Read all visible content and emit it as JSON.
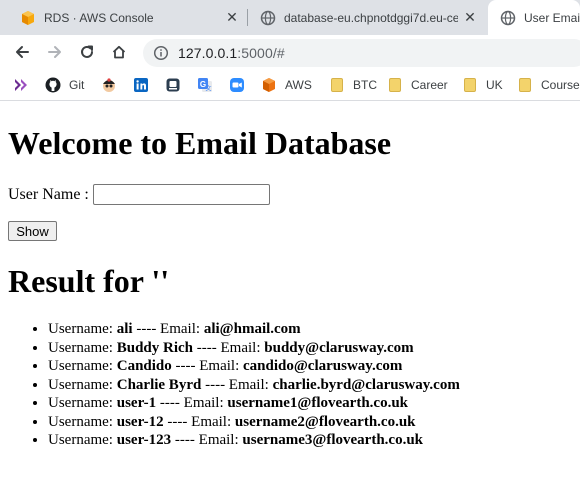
{
  "browser": {
    "tabs": [
      {
        "title": "RDS · AWS Console",
        "icon": "aws-box-icon",
        "active": false
      },
      {
        "title": "database-eu.chpnotdggi7d.eu-ce",
        "icon": "globe-icon",
        "active": false
      },
      {
        "title": "User Emails",
        "icon": "globe-icon",
        "active": true
      }
    ],
    "address": {
      "host": "127.0.0.1",
      "path": ":5000/#"
    },
    "bookmarks": [
      {
        "label": "",
        "icon": "chevrons-icon"
      },
      {
        "label": "Git",
        "icon": "github-icon"
      },
      {
        "label": "",
        "icon": "avatar-icon"
      },
      {
        "label": "",
        "icon": "linkedin-icon"
      },
      {
        "label": "",
        "icon": "bookmark-app-icon"
      },
      {
        "label": "",
        "icon": "google-translate-icon"
      },
      {
        "label": "",
        "icon": "zoom-icon"
      },
      {
        "label": "AWS",
        "icon": "aws-box-icon"
      },
      {
        "label": "BTC",
        "icon": "folder-icon"
      },
      {
        "label": "Career",
        "icon": "folder-icon"
      },
      {
        "label": "UK",
        "icon": "folder-icon"
      },
      {
        "label": "Course",
        "icon": "folder-icon"
      }
    ]
  },
  "page": {
    "heading": "Welcome to Email Database",
    "username_label": "User Name :",
    "username_value": "",
    "show_button": "Show",
    "result_heading": "Result for ''",
    "username_prefix": "Username:",
    "separator": "---- Email:",
    "results": [
      {
        "username": "ali",
        "email": "ali@hmail.com"
      },
      {
        "username": "Buddy Rich",
        "email": "buddy@clarusway.com"
      },
      {
        "username": "Candido",
        "email": "candido@clarusway.com"
      },
      {
        "username": "Charlie Byrd",
        "email": "charlie.byrd@clarusway.com"
      },
      {
        "username": "user-1",
        "email": "username1@flovearth.co.uk"
      },
      {
        "username": "user-12",
        "email": "username2@flovearth.co.uk"
      },
      {
        "username": "user-123",
        "email": "username3@flovearth.co.uk"
      }
    ]
  },
  "colors": {
    "tabstrip_bg": "#dee1e6",
    "omnibox_bg": "#f1f3f4",
    "aws_orange": "#ec7211",
    "linkedin_blue": "#0a66c2",
    "zoom_blue": "#2d8cff",
    "folder_yellow": "#f3d36b"
  }
}
